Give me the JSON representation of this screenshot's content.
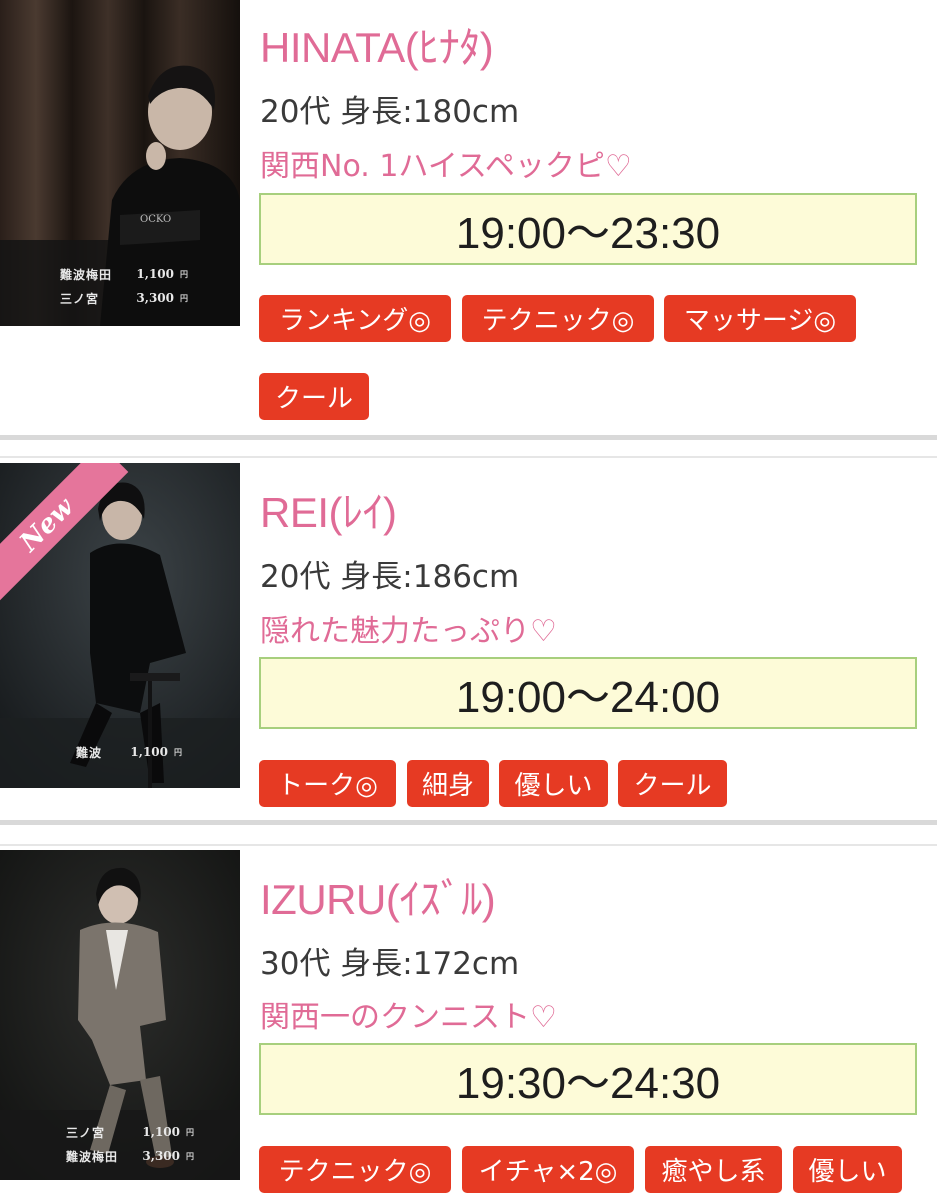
{
  "casts": [
    {
      "name": "HINATA(ﾋﾅﾀ)",
      "meta": "20代 身長:180cm",
      "catch": "関西No. 1ハイスペックピ♡",
      "time": "19:00〜23:30",
      "is_new": false,
      "prices": [
        {
          "area": "難波梅田",
          "value": "1,100",
          "unit": "円"
        },
        {
          "area": "三ノ宮",
          "value": "3,300",
          "unit": "円"
        }
      ],
      "tags": [
        "ランキング◎",
        "テクニック◎",
        "マッサージ◎",
        "クール"
      ]
    },
    {
      "name": "REI(ﾚｲ)",
      "meta": "20代 身長:186cm",
      "catch": "隠れた魅力たっぷり♡",
      "time": "19:00〜24:00",
      "is_new": true,
      "new_label": "New",
      "prices": [
        {
          "area": "難波",
          "value": "1,100",
          "unit": "円"
        }
      ],
      "tags": [
        "トーク◎",
        "細身",
        "優しい",
        "クール"
      ]
    },
    {
      "name": "IZURU(ｲｽﾞﾙ)",
      "meta": "30代 身長:172cm",
      "catch": "関西一のクンニスト♡",
      "time": "19:30〜24:30",
      "is_new": false,
      "prices": [
        {
          "area": "三ノ宮",
          "value": "1,100",
          "unit": "円"
        },
        {
          "area": "難波梅田",
          "value": "3,300",
          "unit": "円"
        }
      ],
      "tags": [
        "テクニック◎",
        "イチャ×2◎",
        "癒やし系",
        "優しい"
      ]
    }
  ],
  "colors": {
    "name": "#e06b96",
    "catch": "#e06b96",
    "tag_bg": "#e63a23",
    "time_bg": "#fdfbd8",
    "time_border": "#a7cf7d",
    "new_ribbon": "#e5759b"
  }
}
